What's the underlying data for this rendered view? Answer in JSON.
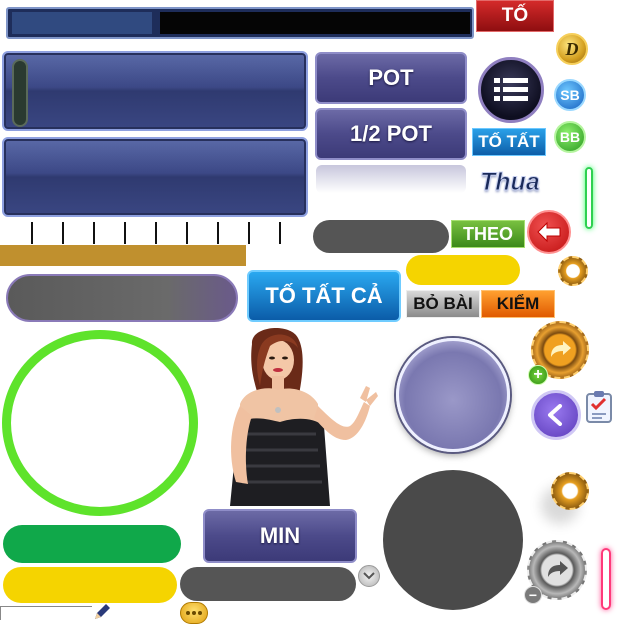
{
  "buttons": {
    "to": "TỐ",
    "pot": "POT",
    "half_pot": "1/2 POT",
    "to_tat": "TỐ TẤT",
    "thua": "Thua",
    "theo": "THEO",
    "to_tat_ca": "TỐ TẤT CẢ",
    "bo_bai": "BỎ BÀI",
    "kiem": "KIỂM",
    "min": "MIN"
  },
  "badges": {
    "dealer": "D",
    "small_blind": "SB",
    "big_blind": "BB"
  },
  "colors": {
    "red_button": "#b3121a",
    "blue_button": "#1a7fc8",
    "green_button": "#4aa02a",
    "orange_button": "#f07a10",
    "green_ring": "#5ee32b",
    "gold_bar": "#c0902e",
    "dark_pill": "#555555",
    "yellow_pill": "#f5d400",
    "green_pill": "#10a84a"
  },
  "icons": {
    "menu": "menu-icon",
    "back": "arrow-left-icon",
    "chevron": "chevron-down-icon",
    "pencil": "pencil-icon",
    "chat": "chat-bubble-icon",
    "checklist": "checklist-icon"
  }
}
